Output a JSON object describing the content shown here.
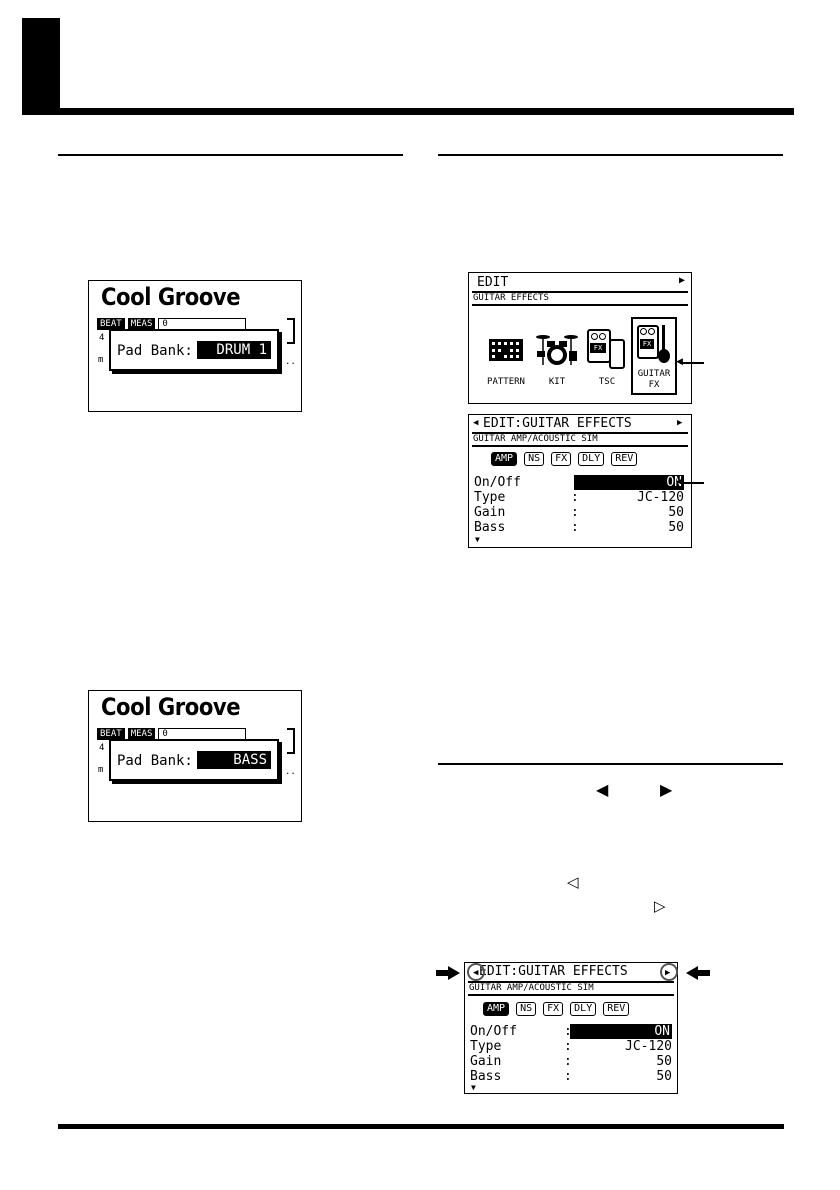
{
  "screens": {
    "pad_bank_drum": {
      "song_title": "Cool Groove",
      "tab1": "BEAT",
      "tab2": "MEAS",
      "tab3": "0",
      "side1": "4",
      "side2": "m",
      "popup_label": "Pad Bank:",
      "popup_value": "DRUM 1"
    },
    "pad_bank_bass": {
      "song_title": "Cool Groove",
      "tab1": "BEAT",
      "tab2": "MEAS",
      "tab3": "0",
      "side1": "4",
      "side2": "m",
      "popup_label": "Pad Bank:",
      "popup_value": "BASS"
    },
    "edit_menu": {
      "title": "EDIT",
      "subtitle": "GUITAR EFFECTS",
      "icons": [
        {
          "label": "PATTERN",
          "icon": "pattern-grid-icon"
        },
        {
          "label": "KIT",
          "icon": "drum-kit-icon"
        },
        {
          "label": "TSC",
          "icon": "tsc-effect-icon"
        },
        {
          "label": "GUITAR",
          "label2": "FX",
          "icon": "guitar-fx-icon"
        }
      ],
      "icon_text": "FX"
    },
    "guitar_effects": {
      "title": "EDIT:GUITAR EFFECTS",
      "subtitle": "GUITAR AMP/ACOUSTIC SIM",
      "tabs": [
        "AMP",
        "NS",
        "FX",
        "DLY",
        "REV"
      ],
      "rows": [
        {
          "label": "On/Off",
          "value": "ON"
        },
        {
          "label": "Type",
          "value": "JC-120"
        },
        {
          "label": "Gain",
          "value": "50"
        },
        {
          "label": "Bass",
          "value": "50"
        }
      ],
      "colon": ":"
    },
    "guitar_effects_2": {
      "title": "EDIT:GUITAR EFFECTS",
      "subtitle": "GUITAR AMP/ACOUSTIC SIM",
      "tabs": [
        "AMP",
        "NS",
        "FX",
        "DLY",
        "REV"
      ],
      "rows": [
        {
          "label": "On/Off",
          "value": "ON"
        },
        {
          "label": "Type",
          "value": "JC-120"
        },
        {
          "label": "Gain",
          "value": "50"
        },
        {
          "label": "Bass",
          "value": "50"
        }
      ],
      "colon": ":"
    }
  }
}
